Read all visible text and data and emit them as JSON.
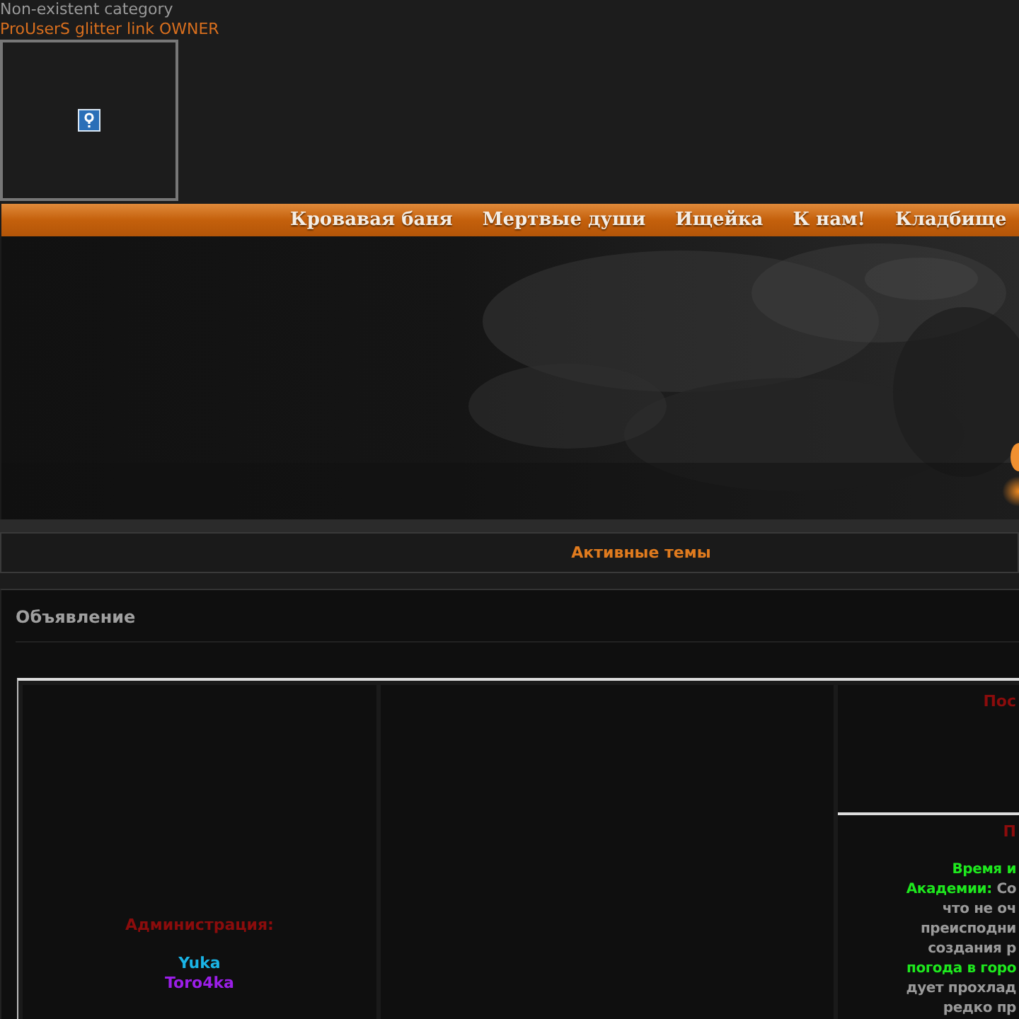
{
  "header": {
    "category": "Non-existent category",
    "link": "ProUserS glitter link OWNER"
  },
  "nav": [
    "Кровавая баня",
    "Мертвые души",
    "Ищейка",
    "К нам!",
    "Кладбище"
  ],
  "active_topics": "Активные темы",
  "announcement": {
    "title": "Объявление",
    "admin_heading": "Администрация:",
    "admins": [
      {
        "name": "Yuka",
        "color": "#1ab4e6"
      },
      {
        "name": "Toro4ka",
        "color": "#9b1ee8"
      }
    ],
    "side_heading_top": "Пос",
    "side_heading_bottom": "П",
    "side_lines": [
      [
        {
          "text": "Время и",
          "kind": "highlight"
        }
      ],
      [
        {
          "text": "Академии:",
          "kind": "highlight"
        },
        {
          "text": "Со",
          "kind": "plain"
        }
      ],
      [
        {
          "text": "что не оч",
          "kind": "plain"
        }
      ],
      [
        {
          "text": "преисподни",
          "kind": "plain"
        }
      ],
      [
        {
          "text": "создания р",
          "kind": "plain"
        }
      ],
      [
        {
          "text": "погода в горо",
          "kind": "highlight"
        }
      ],
      [
        {
          "text": "дует прохлад",
          "kind": "plain"
        }
      ],
      [
        {
          "text": "редко пр",
          "kind": "plain"
        }
      ]
    ]
  }
}
